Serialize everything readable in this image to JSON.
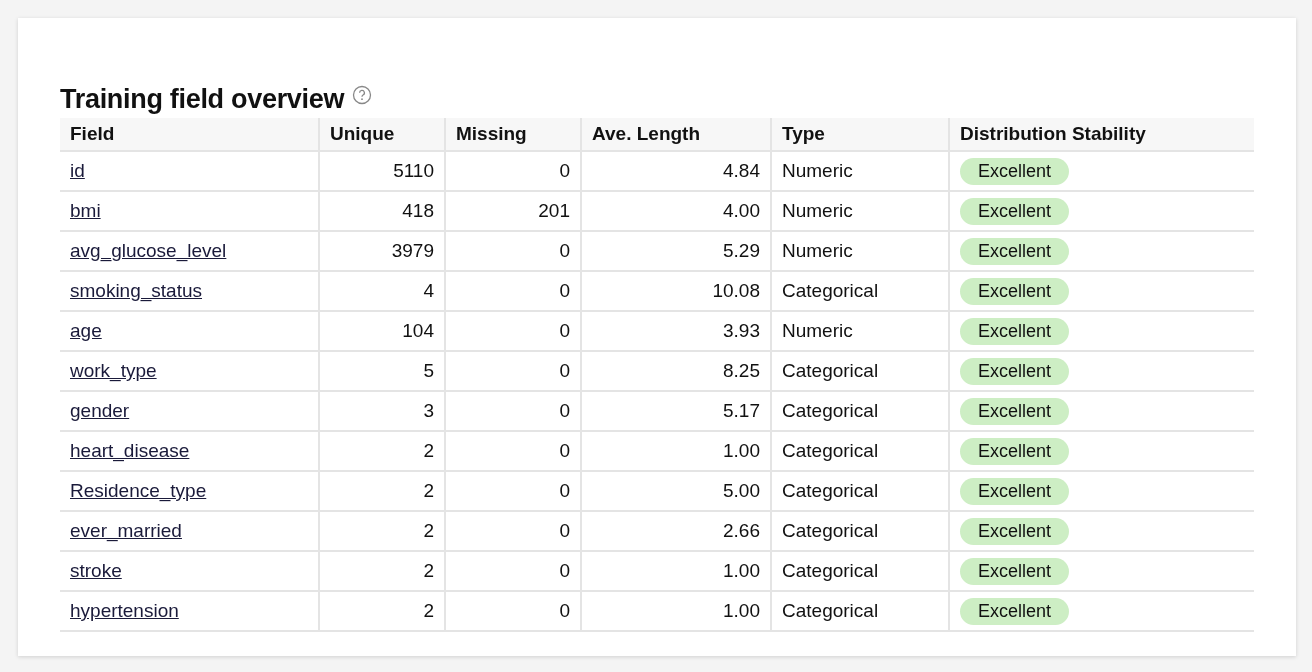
{
  "title": "Training field overview",
  "table": {
    "columns": [
      "Field",
      "Unique",
      "Missing",
      "Ave. Length",
      "Type",
      "Distribution Stability"
    ],
    "rows": [
      {
        "field": "id",
        "unique": "5110",
        "missing": "0",
        "ave_length": "4.84",
        "type": "Numeric",
        "stability": "Excellent"
      },
      {
        "field": "bmi",
        "unique": "418",
        "missing": "201",
        "ave_length": "4.00",
        "type": "Numeric",
        "stability": "Excellent"
      },
      {
        "field": "avg_glucose_level",
        "unique": "3979",
        "missing": "0",
        "ave_length": "5.29",
        "type": "Numeric",
        "stability": "Excellent"
      },
      {
        "field": "smoking_status",
        "unique": "4",
        "missing": "0",
        "ave_length": "10.08",
        "type": "Categorical",
        "stability": "Excellent"
      },
      {
        "field": "age",
        "unique": "104",
        "missing": "0",
        "ave_length": "3.93",
        "type": "Numeric",
        "stability": "Excellent"
      },
      {
        "field": "work_type",
        "unique": "5",
        "missing": "0",
        "ave_length": "8.25",
        "type": "Categorical",
        "stability": "Excellent"
      },
      {
        "field": "gender",
        "unique": "3",
        "missing": "0",
        "ave_length": "5.17",
        "type": "Categorical",
        "stability": "Excellent"
      },
      {
        "field": "heart_disease",
        "unique": "2",
        "missing": "0",
        "ave_length": "1.00",
        "type": "Categorical",
        "stability": "Excellent"
      },
      {
        "field": "Residence_type",
        "unique": "2",
        "missing": "0",
        "ave_length": "5.00",
        "type": "Categorical",
        "stability": "Excellent"
      },
      {
        "field": "ever_married",
        "unique": "2",
        "missing": "0",
        "ave_length": "2.66",
        "type": "Categorical",
        "stability": "Excellent"
      },
      {
        "field": "stroke",
        "unique": "2",
        "missing": "0",
        "ave_length": "1.00",
        "type": "Categorical",
        "stability": "Excellent"
      },
      {
        "field": "hypertension",
        "unique": "2",
        "missing": "0",
        "ave_length": "1.00",
        "type": "Categorical",
        "stability": "Excellent"
      }
    ]
  }
}
